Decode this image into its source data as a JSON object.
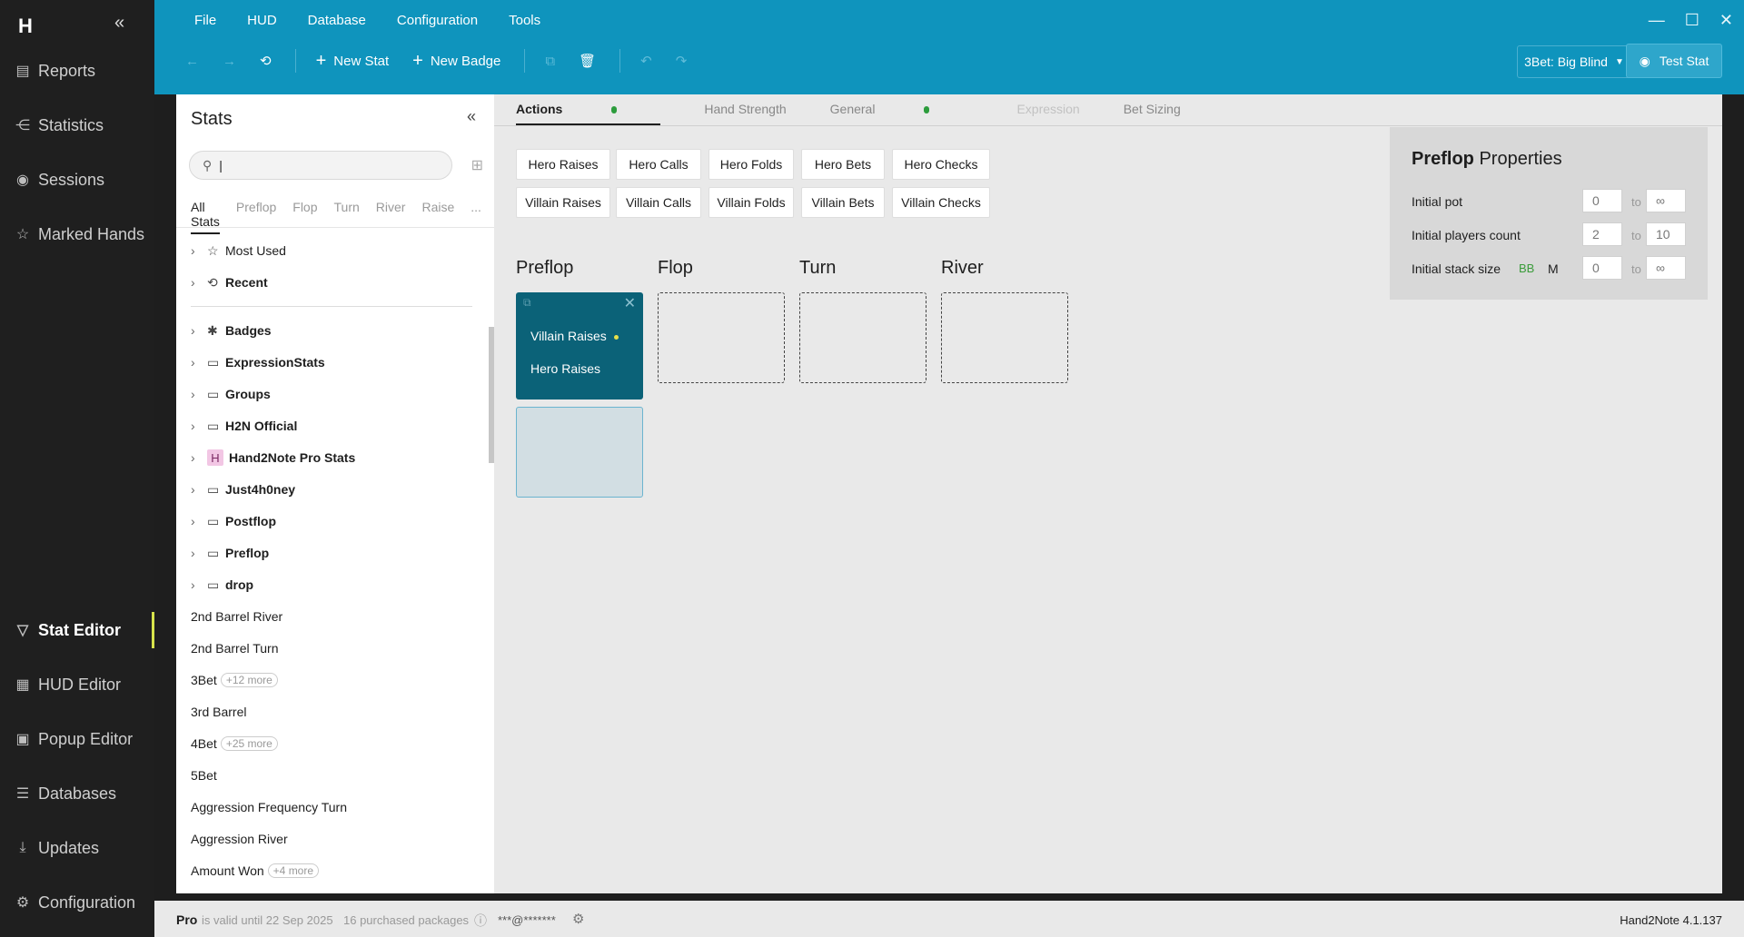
{
  "app": {
    "logo": "H",
    "version": "Hand2Note 4.1.137"
  },
  "nav": {
    "collapse": "«",
    "items": [
      {
        "label": "Reports",
        "icon": "report-icon"
      },
      {
        "label": "Statistics",
        "icon": "statistics-icon"
      },
      {
        "label": "Sessions",
        "icon": "sessions-icon"
      },
      {
        "label": "Marked Hands",
        "icon": "marked-hands-icon"
      },
      {
        "label": "Stat Editor",
        "icon": "filter-icon",
        "active": true
      },
      {
        "label": "HUD Editor",
        "icon": "hud-icon"
      },
      {
        "label": "Popup Editor",
        "icon": "popup-icon"
      },
      {
        "label": "Databases",
        "icon": "database-icon"
      },
      {
        "label": "Updates",
        "icon": "download-icon"
      },
      {
        "label": "Configuration",
        "icon": "gear-icon"
      }
    ]
  },
  "menu": [
    "File",
    "HUD",
    "Database",
    "Configuration",
    "Tools"
  ],
  "toolbar": {
    "new_stat": "New Stat",
    "new_badge": "New Badge",
    "dropdown": "3Bet: Big Blind",
    "test_stat": "Test Stat"
  },
  "stats": {
    "title": "Stats",
    "filters": [
      "All Stats",
      "Preflop",
      "Flop",
      "Turn",
      "River",
      "Raise",
      "..."
    ],
    "special": [
      {
        "label": "Most Used",
        "icon": "☆"
      },
      {
        "label": "Recent",
        "icon": "⟲"
      }
    ],
    "folders": [
      {
        "label": "Badges",
        "icon": "✱"
      },
      {
        "label": "ExpressionStats",
        "icon": "▭"
      },
      {
        "label": "Groups",
        "icon": "▭"
      },
      {
        "label": "H2N Official",
        "icon": "▭"
      },
      {
        "label": "Hand2Note Pro Stats",
        "icon": "H"
      },
      {
        "label": "Just4h0ney",
        "icon": "▭"
      },
      {
        "label": "Postflop",
        "icon": "▭"
      },
      {
        "label": "Preflop",
        "icon": "▭"
      },
      {
        "label": "drop",
        "icon": "▭"
      }
    ],
    "items": [
      {
        "label": "2nd Barrel River",
        "more": ""
      },
      {
        "label": "2nd Barrel Turn",
        "more": ""
      },
      {
        "label": "3Bet",
        "more": "+12 more"
      },
      {
        "label": "3rd Barrel",
        "more": ""
      },
      {
        "label": "4Bet",
        "more": "+25 more"
      },
      {
        "label": "5Bet",
        "more": ""
      },
      {
        "label": "Aggression Frequency Turn",
        "more": ""
      },
      {
        "label": "Aggression River",
        "more": ""
      },
      {
        "label": "Amount Won",
        "more": "+4 more"
      }
    ]
  },
  "editor": {
    "tabs": [
      "Actions",
      "Hand Strength",
      "General",
      "Expression",
      "Bet Sizing"
    ],
    "hero_actions": [
      "Hero Raises",
      "Hero Calls",
      "Hero Folds",
      "Hero Bets",
      "Hero Checks"
    ],
    "villain_actions": [
      "Villain Raises",
      "Villain Calls",
      "Villain Folds",
      "Villain Bets",
      "Villain Checks"
    ],
    "streets": [
      "Preflop",
      "Flop",
      "Turn",
      "River"
    ],
    "preflop_card": [
      "Villain Raises",
      "Hero Raises"
    ]
  },
  "properties": {
    "title_bold": "Preflop",
    "title_rest": "Properties",
    "to": "to",
    "rows": [
      {
        "label": "Initial pot",
        "from": "0",
        "to_value": "∞"
      },
      {
        "label": "Initial players count",
        "from": "2",
        "to_value": "10"
      },
      {
        "label": "Initial stack size",
        "from": "0",
        "to_value": "∞"
      }
    ],
    "bb": "BB",
    "m": "M",
    "bb_color": "#3a9c3a"
  },
  "status": {
    "plan": "Pro",
    "valid": "is valid until 22 Sep 2025",
    "packages": "16 purchased packages",
    "user": "***@*******"
  },
  "colors": {
    "accent": "#0f94bd",
    "sidebar": "#1f1f1f",
    "card": "#0b6278",
    "active_marker": "#d7e34b"
  }
}
